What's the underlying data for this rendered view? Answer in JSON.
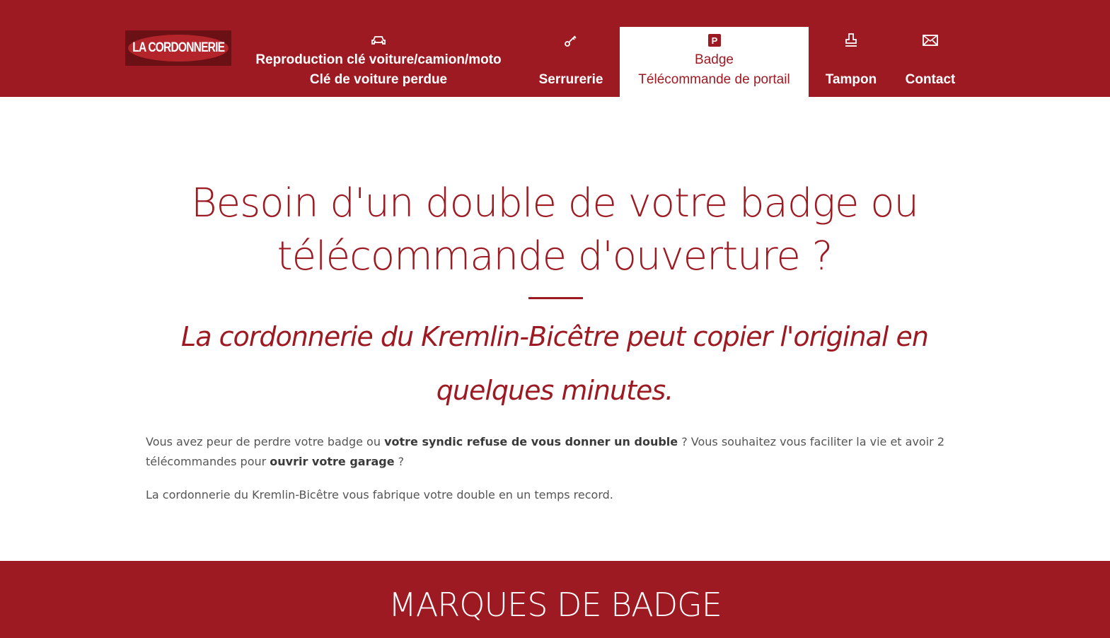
{
  "header": {
    "logo_text": "LA CORDONNERIE",
    "nav": [
      {
        "icon": "car-icon",
        "line1": "Reproduction clé voiture/camion/moto",
        "line2": "Clé de voiture perdue"
      },
      {
        "icon": "key-icon",
        "line1": "",
        "line2": "Serrurerie"
      },
      {
        "icon": "parking-icon",
        "line1": "Badge",
        "line2": "Télécommande de portail",
        "active": true
      },
      {
        "icon": "stamp-icon",
        "line1": "",
        "line2": "Tampon"
      },
      {
        "icon": "envelope-icon",
        "line1": "",
        "line2": "Contact"
      }
    ]
  },
  "hero": {
    "title": "Besoin d'un double de votre badge ou télécommande d'ouverture ?",
    "tagline": "La cordonnerie du Kremlin-Bicêtre peut copier l'original en quelques minutes."
  },
  "content": {
    "p1_a": "Vous avez peur de perdre votre badge ou ",
    "p1_b": "votre syndic refuse de vous donner un double",
    "p1_c": " ? Vous souhaitez vous faciliter la vie et avoir 2 télécommandes pour ",
    "p1_d": "ouvrir votre garage",
    "p1_e": " ?",
    "p2": "La cordonnerie du Kremlin-Bicêtre vous fabrique votre double en un temps record."
  },
  "brands": {
    "title": "MARQUES DE BADGE"
  },
  "colors": {
    "brand": "#9e1a22",
    "text": "#555555",
    "white": "#ffffff"
  }
}
